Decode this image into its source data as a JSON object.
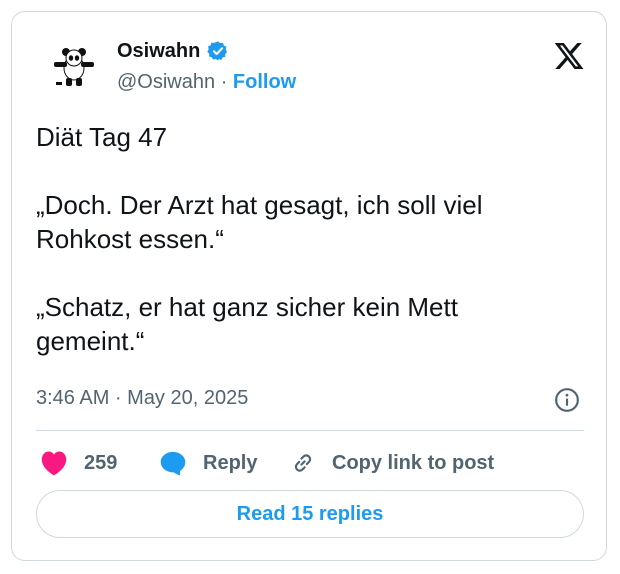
{
  "author": {
    "name": "Osiwahn",
    "handle": "@Osiwahn",
    "separator": "·",
    "follow_label": "Follow"
  },
  "tweet": {
    "paragraphs": [
      "Diät Tag 47",
      "„Doch. Der Arzt hat gesagt, ich soll viel\nRohkost essen.“",
      "„Schatz, er hat ganz sicher kein Mett\ngemeint.“"
    ],
    "time": "3:46 AM · May 20, 2025"
  },
  "actions": {
    "likes_count": "259",
    "reply_label": "Reply",
    "copy_link_label": "Copy link to post",
    "read_replies_label": "Read 15 replies"
  },
  "colors": {
    "accent": "#1d9bf0",
    "like": "#f91880",
    "border": "#cfd9de",
    "secondary_text": "#536471"
  },
  "icons": [
    "panda-avatar",
    "verified-badge-icon",
    "x-logo-icon",
    "info-icon",
    "heart-icon",
    "reply-bubble-icon",
    "link-icon"
  ]
}
